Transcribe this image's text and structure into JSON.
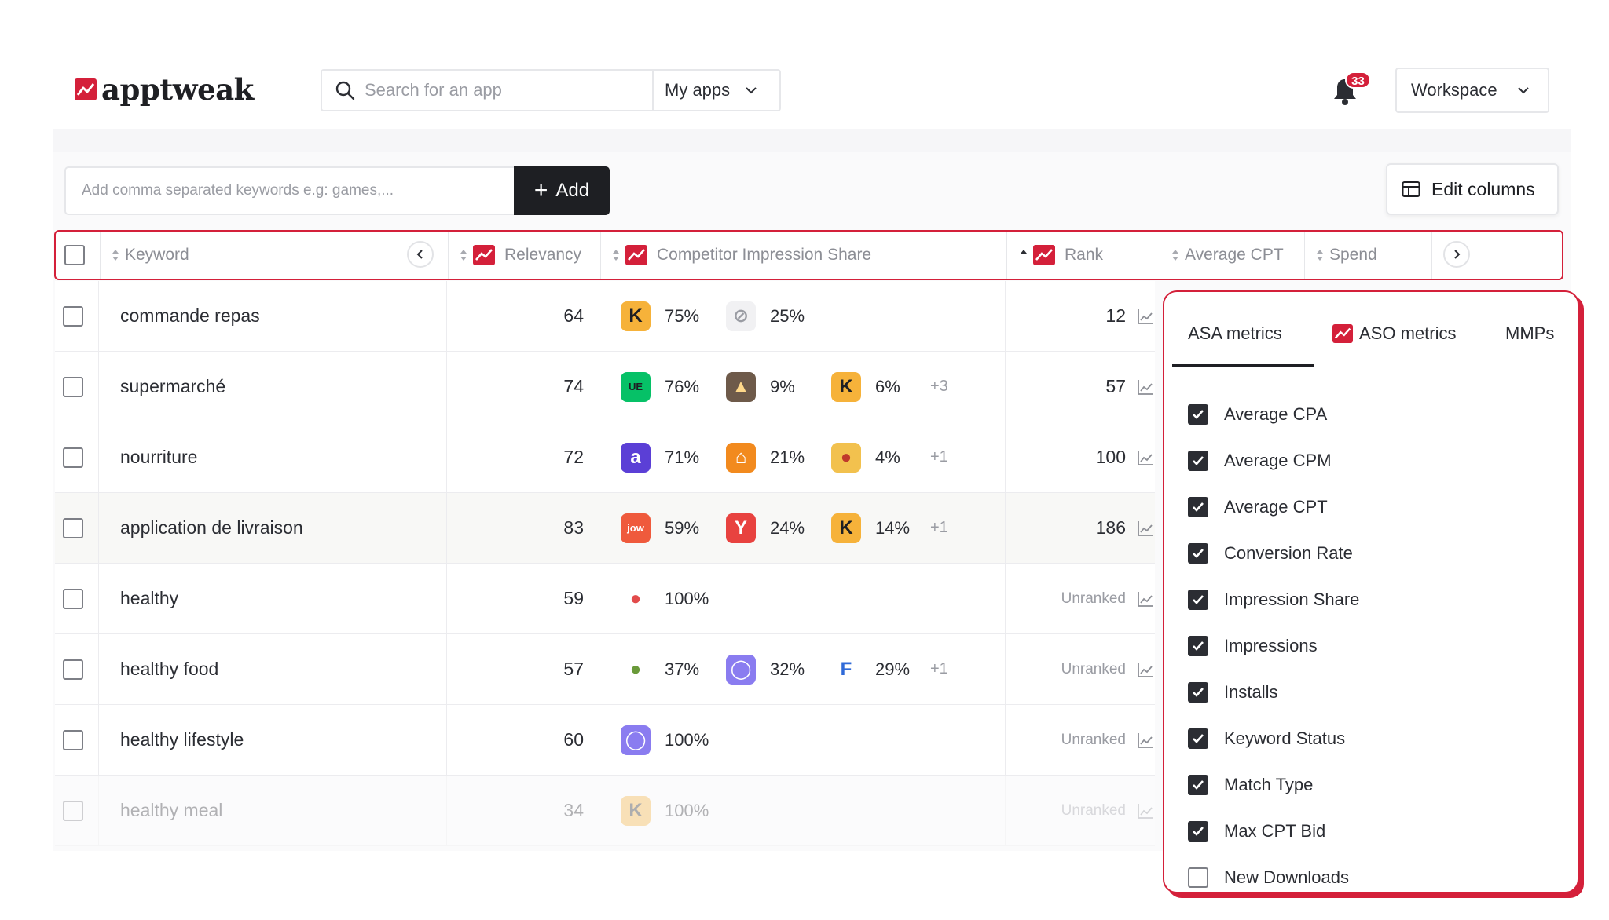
{
  "brand": {
    "name": "apptweak",
    "accent": "#d4203a"
  },
  "header": {
    "search_placeholder": "Search for an app",
    "scope_label": "My apps",
    "notification_count": "33",
    "workspace_label": "Workspace"
  },
  "keyword_bar": {
    "placeholder": "Add comma separated keywords e.g: games,...",
    "add_label": "Add",
    "edit_columns_label": "Edit columns"
  },
  "table": {
    "columns": [
      "Keyword",
      "Relevancy",
      "Competitor Impression Share",
      "Rank",
      "Average CPT",
      "Spend"
    ],
    "unranked_label": "Unranked",
    "rows": [
      {
        "keyword": "commande repas",
        "relevancy": "64",
        "competitors": [
          {
            "icon": "kiosque-k-icon",
            "share": "75%"
          },
          {
            "icon": "blocked-icon",
            "share": "25%"
          }
        ],
        "more": "",
        "rank": "12"
      },
      {
        "keyword": "supermarché",
        "relevancy": "74",
        "competitors": [
          {
            "icon": "uber-eats-icon",
            "share": "76%"
          },
          {
            "icon": "photo-app-icon",
            "share": "9%"
          },
          {
            "icon": "kiosque-k-icon",
            "share": "6%"
          }
        ],
        "more": "+3",
        "rank": "57"
      },
      {
        "keyword": "nourriture",
        "relevancy": "72",
        "competitors": [
          {
            "icon": "purple-a-icon",
            "share": "71%"
          },
          {
            "icon": "orange-house-icon",
            "share": "21%"
          },
          {
            "icon": "food-game-icon",
            "share": "4%"
          }
        ],
        "more": "+1",
        "rank": "100"
      },
      {
        "keyword": "application de livraison",
        "relevancy": "83",
        "competitors": [
          {
            "icon": "jow-icon",
            "share": "59%"
          },
          {
            "icon": "red-y-icon",
            "share": "24%"
          },
          {
            "icon": "kiosque-k-icon",
            "share": "14%"
          }
        ],
        "more": "+1",
        "rank": "186"
      },
      {
        "keyword": "healthy",
        "relevancy": "59",
        "competitors": [
          {
            "icon": "fruit-icon",
            "share": "100%"
          }
        ],
        "more": "",
        "rank": "Unranked"
      },
      {
        "keyword": "healthy food",
        "relevancy": "57",
        "competitors": [
          {
            "icon": "avocado-icon",
            "share": "37%"
          },
          {
            "icon": "purple-ring-icon",
            "share": "32%"
          },
          {
            "icon": "f-logo-icon",
            "share": "29%"
          }
        ],
        "more": "+1",
        "rank": "Unranked"
      },
      {
        "keyword": "healthy lifestyle",
        "relevancy": "60",
        "competitors": [
          {
            "icon": "purple-ring-icon",
            "share": "100%"
          }
        ],
        "more": "",
        "rank": "Unranked"
      },
      {
        "keyword": "healthy meal",
        "relevancy": "34",
        "competitors": [
          {
            "icon": "kiosque-k-icon",
            "share": "100%"
          }
        ],
        "more": "",
        "rank": "Unranked"
      }
    ]
  },
  "edit_columns_menu": {
    "tabs": [
      "ASA metrics",
      "ASO metrics",
      "MMPs"
    ],
    "active_tab": "ASA metrics",
    "options": [
      {
        "label": "Average CPA",
        "checked": true
      },
      {
        "label": "Average CPM",
        "checked": true
      },
      {
        "label": "Average CPT",
        "checked": true
      },
      {
        "label": "Conversion Rate",
        "checked": true
      },
      {
        "label": "Impression Share",
        "checked": true
      },
      {
        "label": "Impressions",
        "checked": true
      },
      {
        "label": "Installs",
        "checked": true
      },
      {
        "label": "Keyword Status",
        "checked": true
      },
      {
        "label": "Match Type",
        "checked": true
      },
      {
        "label": "Max CPT Bid",
        "checked": true
      },
      {
        "label": "New Downloads",
        "checked": false
      }
    ]
  }
}
